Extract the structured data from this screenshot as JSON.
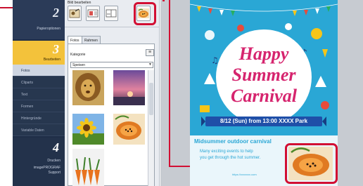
{
  "steps": {
    "step2": {
      "number": "2",
      "label": "Papieroptionen"
    },
    "step3": {
      "number": "3",
      "label": "Bearbeiten"
    },
    "subitems": [
      "Fotos",
      "Cliparts",
      "Text",
      "Formen",
      "Hintergründe",
      "Variable Daten"
    ],
    "active_subitem_index": 0,
    "step4": {
      "number": "4",
      "label": "Drucken",
      "product_line1": "imagePROGRAF",
      "product_line2": "Support"
    }
  },
  "edit_panel": {
    "title": "Bild bearbeiten",
    "tools": [
      "photo-edit-icon",
      "layout-icon",
      "layout-split-icon",
      "photo-replace-icon"
    ],
    "highlighted_tool": "photo-replace-icon",
    "tabs": [
      "Fotos",
      "Rahmen"
    ],
    "active_tab": "Fotos",
    "category_label": "Kategorie",
    "category_selected": "Speisen",
    "thumbnails": [
      "lion",
      "sunset",
      "sunflower",
      "papaya",
      "carrots"
    ]
  },
  "poster": {
    "title_line1": "Happy",
    "title_line2": "Summer",
    "title_line3": "Carnival",
    "date_banner": "8/12 (Sun) from 13:00  XXXX Park",
    "subtitle": "Midsummer outdoor carnival",
    "body_line1": "Many exciting events to help",
    "body_line2": "you get through the hot summer.",
    "url": "https://xxxxxxx.com",
    "replaced_photo": "papaya"
  },
  "colors": {
    "highlight": "#d20f33",
    "poster_bg": "#2aa7d5",
    "sidebar_bg": "#1f2e47",
    "active_step": "#f3c23b"
  }
}
